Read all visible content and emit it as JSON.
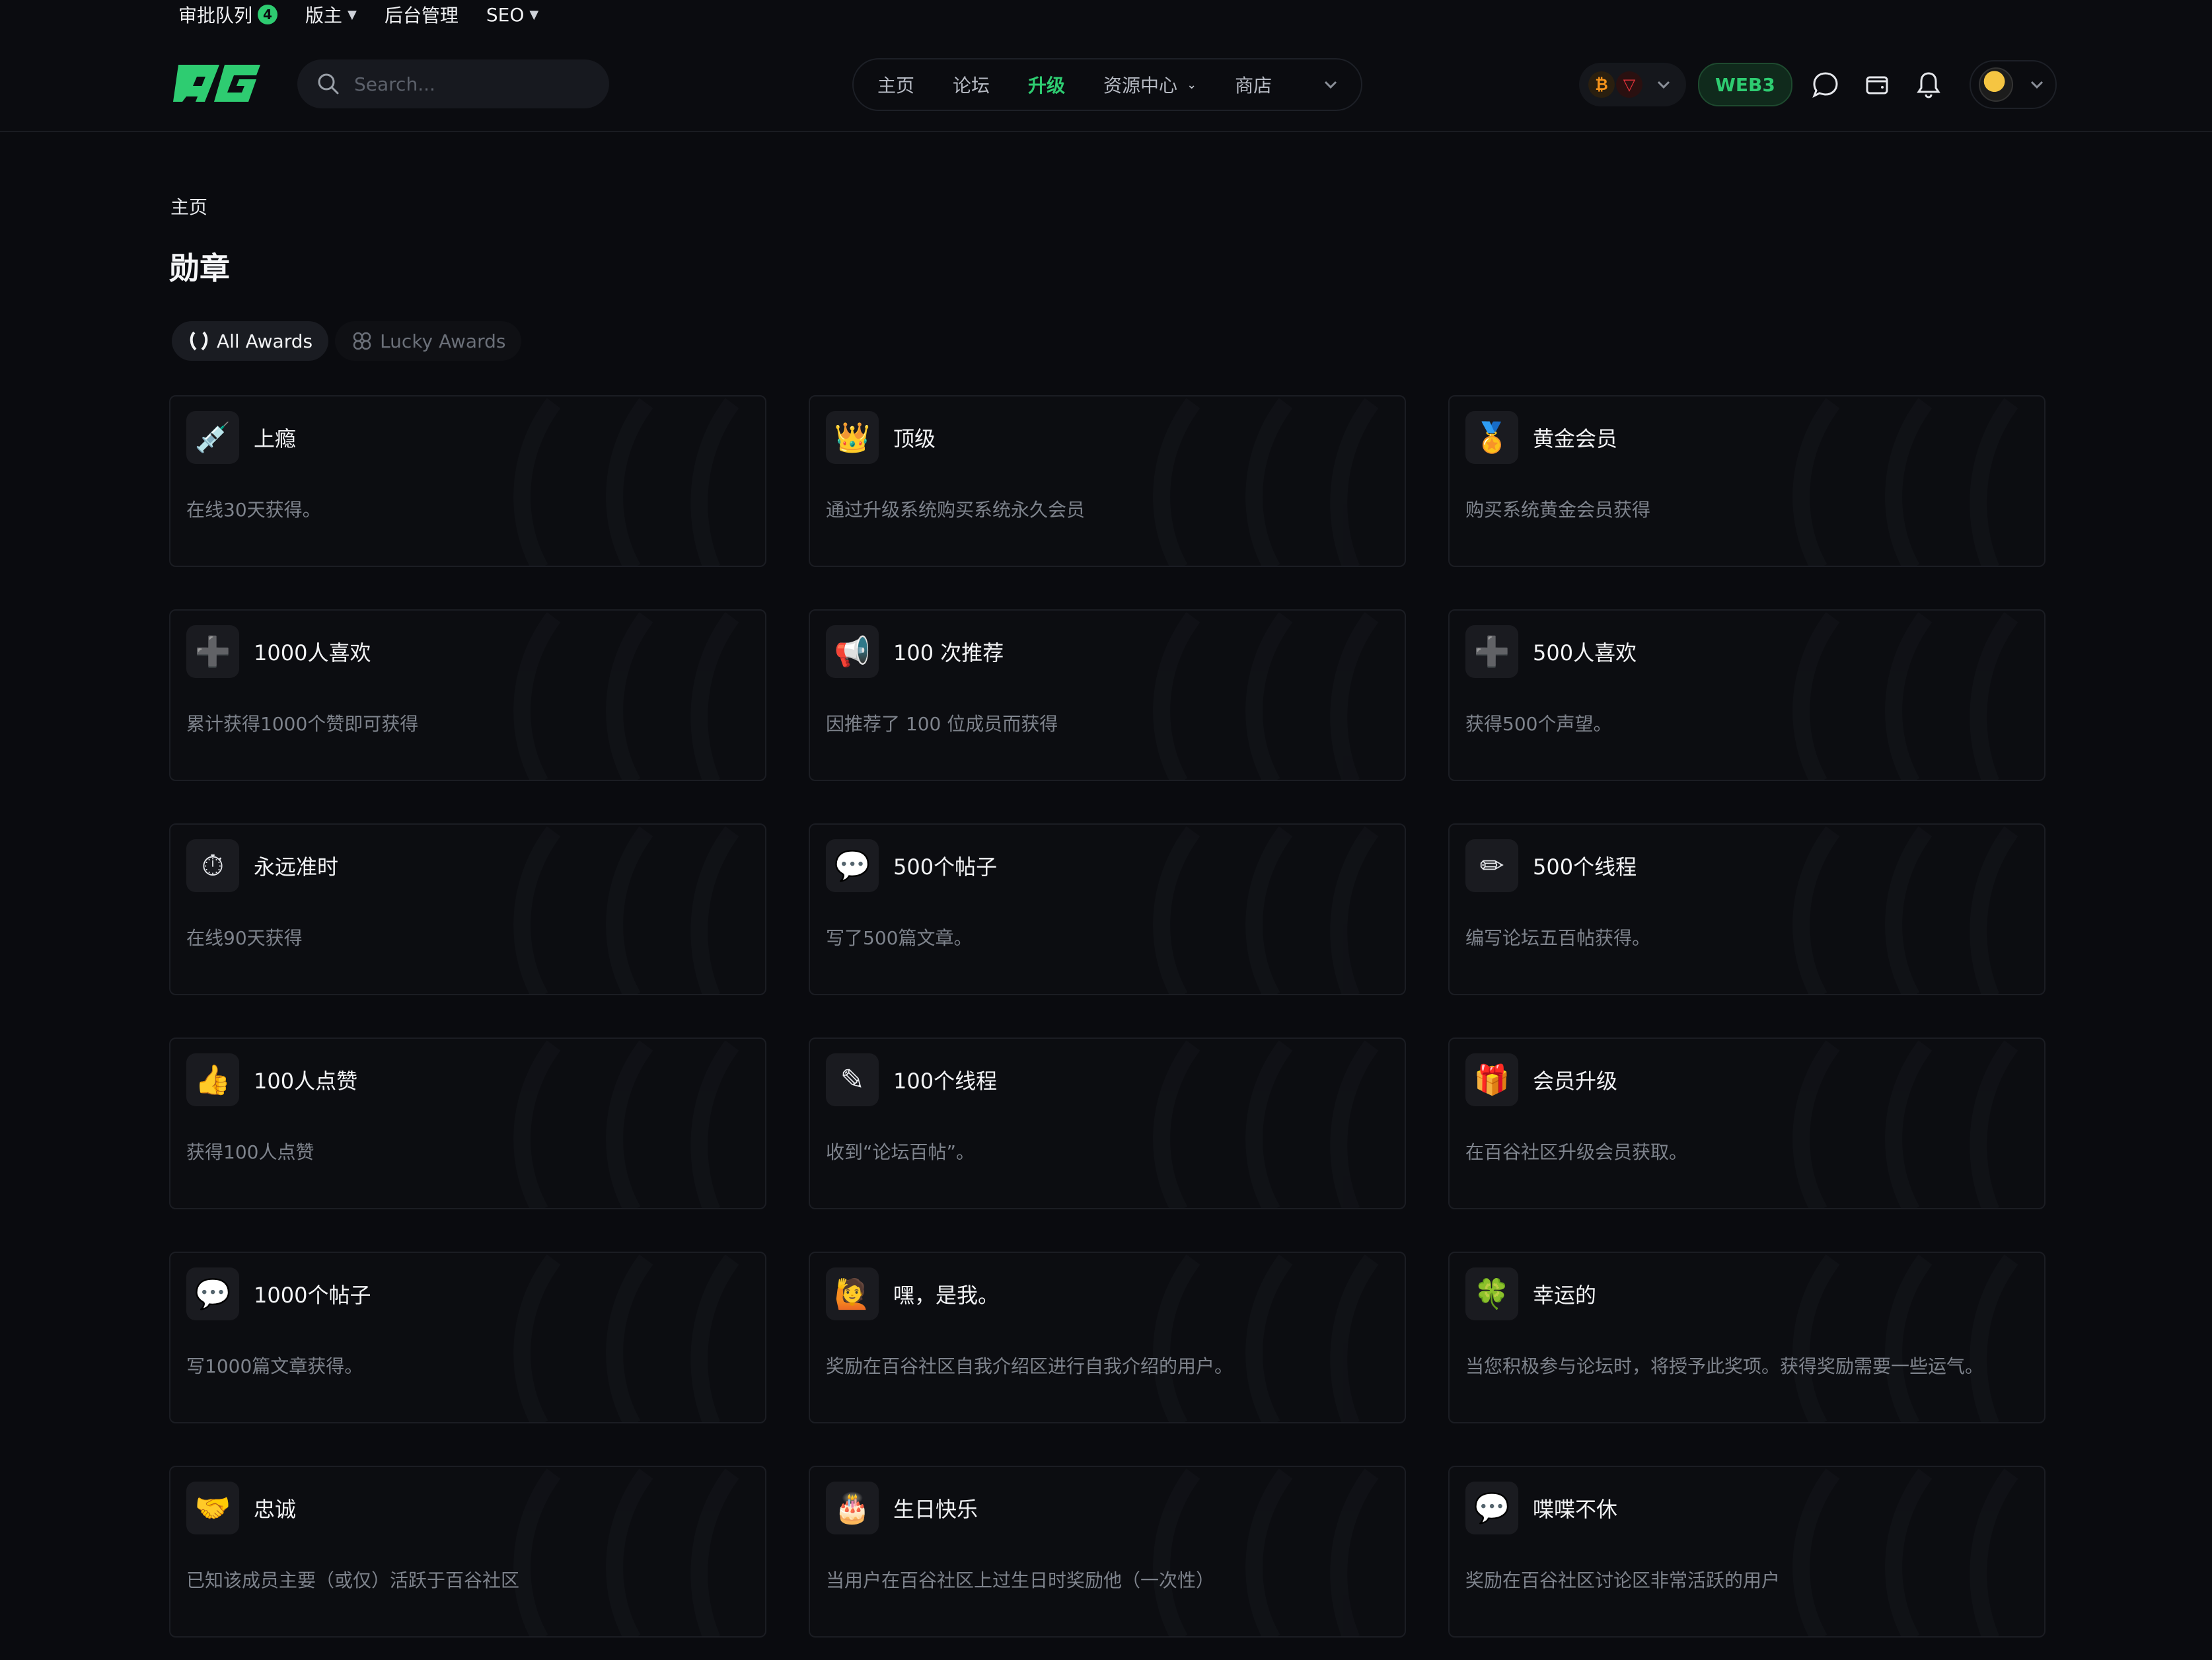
{
  "admin_bar": {
    "items": [
      {
        "label": "审批队列",
        "badge": "4"
      },
      {
        "label": "版主",
        "dropdown": true
      },
      {
        "label": "后台管理"
      },
      {
        "label": "SEO",
        "dropdown": true
      }
    ]
  },
  "header": {
    "search_placeholder": "Search...",
    "nav": [
      {
        "label": "主页",
        "active": false
      },
      {
        "label": "论坛",
        "active": false
      },
      {
        "label": "升级",
        "active": true
      },
      {
        "label": "资源中心",
        "active": false,
        "dropdown": true
      },
      {
        "label": "商店",
        "active": false
      }
    ],
    "web3_label": "WEB3",
    "accent_color": "#2ecc71"
  },
  "breadcrumb": "主页",
  "page_title": "勋章",
  "tabs": [
    {
      "label": "All Awards",
      "active": true
    },
    {
      "label": "Lucky Awards",
      "active": false
    }
  ],
  "awards": [
    {
      "title": "上瘾",
      "desc": "在线30天获得。",
      "icon": "💉"
    },
    {
      "title": "顶级",
      "desc": "通过升级系统购买系统永久会员",
      "icon": "👑"
    },
    {
      "title": "黄金会员",
      "desc": "购买系统黄金会员获得",
      "icon": "🏅"
    },
    {
      "title": "1000人喜欢",
      "desc": "累计获得1000个赞即可获得",
      "icon": "➕"
    },
    {
      "title": "100 次推荐",
      "desc": "因推荐了 100 位成员而获得",
      "icon": "📢"
    },
    {
      "title": "500人喜欢",
      "desc": "获得500个声望。",
      "icon": "➕"
    },
    {
      "title": "永远准时",
      "desc": "在线90天获得",
      "icon": "⏱"
    },
    {
      "title": "500个帖子",
      "desc": "写了500篇文章。",
      "icon": "💬"
    },
    {
      "title": "500个线程",
      "desc": "编写论坛五百帖获得。",
      "icon": "✏"
    },
    {
      "title": "100人点赞",
      "desc": "获得100人点赞",
      "icon": "👍"
    },
    {
      "title": "100个线程",
      "desc": "收到“论坛百帖”。",
      "icon": "✎"
    },
    {
      "title": "会员升级",
      "desc": "在百谷社区升级会员获取。",
      "icon": "🎁"
    },
    {
      "title": "1000个帖子",
      "desc": "写1000篇文章获得。",
      "icon": "💬"
    },
    {
      "title": "嘿，是我。",
      "desc": "奖励在百谷社区自我介绍区进行自我介绍的用户。",
      "icon": "🙋"
    },
    {
      "title": "幸运的",
      "desc": "当您积极参与论坛时，将授予此奖项。获得奖励需要一些运气。",
      "icon": "🍀"
    },
    {
      "title": "忠诚",
      "desc": "已知该成员主要（或仅）活跃于百谷社区",
      "icon": "🤝"
    },
    {
      "title": "生日快乐",
      "desc": "当用户在百谷社区上过生日时奖励他（一次性）",
      "icon": "🎂"
    },
    {
      "title": "喋喋不休",
      "desc": "奖励在百谷社区讨论区非常活跃的用户",
      "icon": "💬"
    }
  ]
}
